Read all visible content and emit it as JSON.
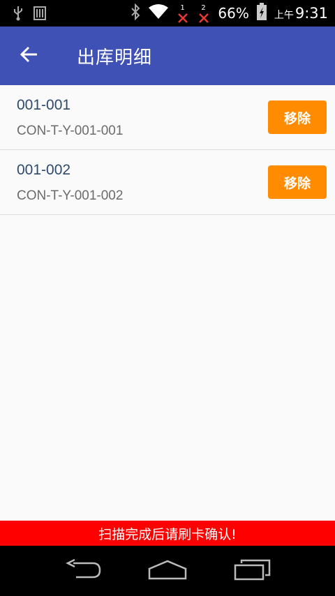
{
  "status_bar": {
    "battery_percent": "66%",
    "time_prefix": "上午",
    "time": "9:31",
    "sim1_label": "1",
    "sim2_label": "2"
  },
  "app_bar": {
    "title": "出库明细",
    "back_icon": "arrow-back-icon",
    "color": "#3f51b5"
  },
  "items": [
    {
      "code": "001-001",
      "container": "CON-T-Y-001-001",
      "remove_label": "移除"
    },
    {
      "code": "001-002",
      "container": "CON-T-Y-001-002",
      "remove_label": "移除"
    }
  ],
  "banner": {
    "text": "扫描完成后请刷卡确认!",
    "color": "#ff0000"
  },
  "nav": {
    "back_icon": "nav-back-icon",
    "home_icon": "nav-home-icon",
    "recents_icon": "nav-recents-icon"
  },
  "accent_color": "#ff8c00"
}
